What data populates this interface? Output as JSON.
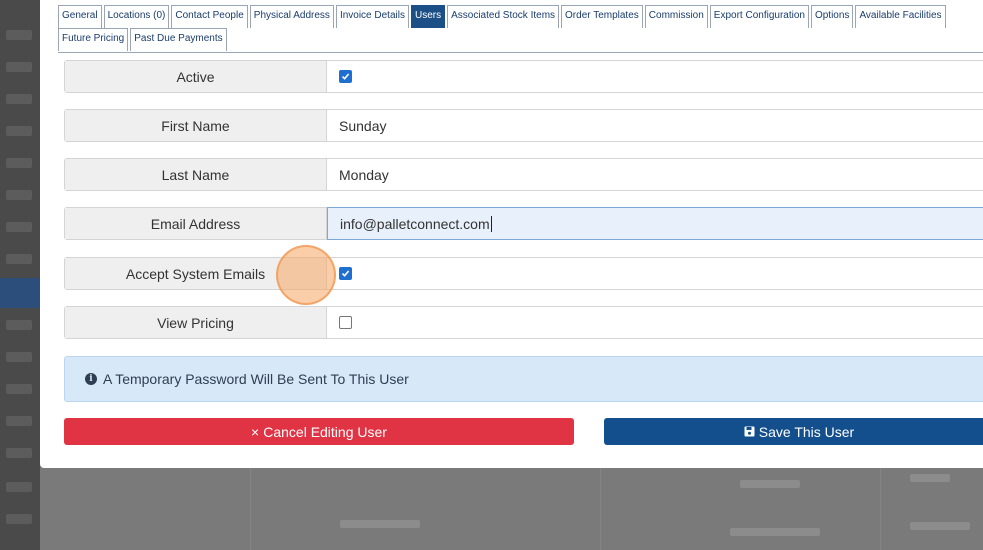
{
  "tabs": {
    "row1": [
      "General",
      "Locations (0)",
      "Contact People",
      "Physical Address",
      "Invoice Details",
      "Users",
      "Associated Stock Items",
      "Order Templates",
      "Commission",
      "Export Configuration",
      "Options",
      "Available Facilities"
    ],
    "row2": [
      "Future Pricing",
      "Past Due Payments"
    ],
    "active": "Users"
  },
  "form": {
    "active_label": "Active",
    "active_checked": true,
    "first_name_label": "First Name",
    "first_name_value": "Sunday",
    "last_name_label": "Last Name",
    "last_name_value": "Monday",
    "email_label": "Email Address",
    "email_value": "info@palletconnect.com",
    "accept_emails_label": "Accept System Emails",
    "accept_emails_checked": true,
    "view_pricing_label": "View Pricing",
    "view_pricing_checked": false
  },
  "info": {
    "icon": "info-circle-icon",
    "text": "A Temporary Password Will Be Sent To This User"
  },
  "buttons": {
    "cancel_label": "Cancel Editing User",
    "cancel_icon": "close-icon",
    "save_label": "Save This User",
    "save_icon": "floppy-disk-icon"
  },
  "colors": {
    "active_tab": "#1c4f86",
    "cancel": "#e03445",
    "save": "#124f8c",
    "info_bg": "#d7e8f8",
    "checkbox": "#1f6fd1"
  }
}
